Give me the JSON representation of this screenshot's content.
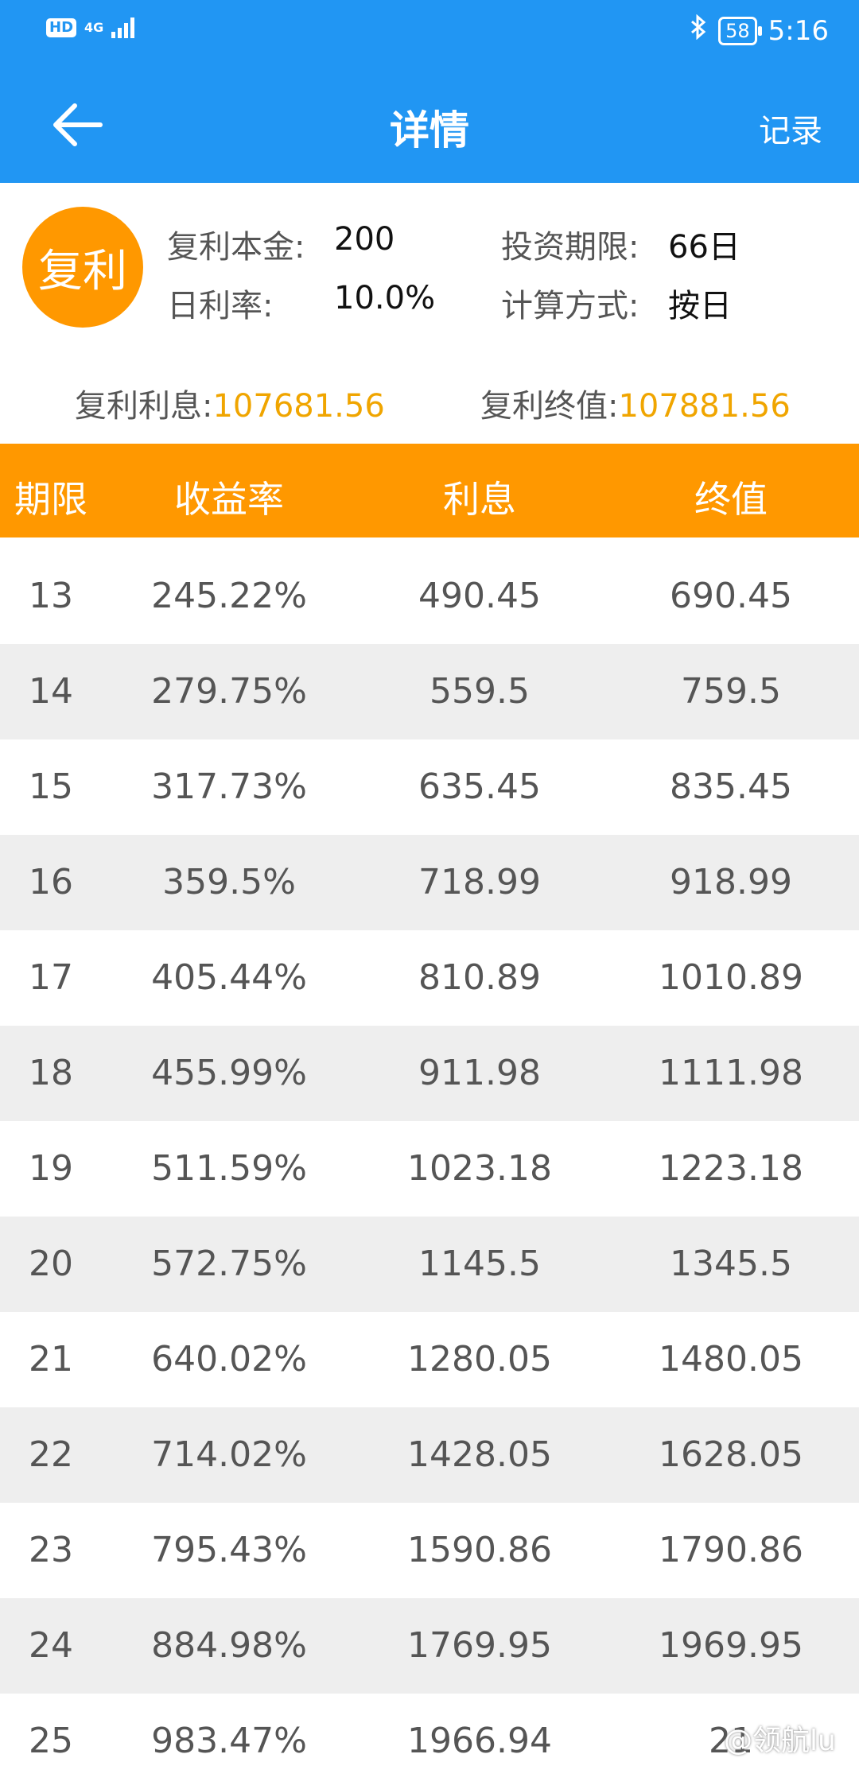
{
  "status": {
    "hd": "HD",
    "network": "4G",
    "battery": "58",
    "time": "5:16",
    "bluetooth_icon": "bluetooth-icon"
  },
  "toolbar": {
    "title": "详情",
    "record_label": "记录"
  },
  "summary": {
    "badge": "复利",
    "principal_label": "复利本金:",
    "principal_value": "200",
    "period_label": "投资期限:",
    "period_value": "66日",
    "rate_label": "日利率:",
    "rate_value": "10.0%",
    "method_label": "计算方式:",
    "method_value": "按日",
    "interest_label": "复利利息:",
    "interest_value": "107681.56",
    "final_label": "复利终值:",
    "final_value": "107881.56"
  },
  "table": {
    "headers": [
      "期限",
      "收益率",
      "利息",
      "终值"
    ],
    "rows": [
      [
        "13",
        "245.22%",
        "490.45",
        "690.45"
      ],
      [
        "14",
        "279.75%",
        "559.5",
        "759.5"
      ],
      [
        "15",
        "317.73%",
        "635.45",
        "835.45"
      ],
      [
        "16",
        "359.5%",
        "718.99",
        "918.99"
      ],
      [
        "17",
        "405.44%",
        "810.89",
        "1010.89"
      ],
      [
        "18",
        "455.99%",
        "911.98",
        "1111.98"
      ],
      [
        "19",
        "511.59%",
        "1023.18",
        "1223.18"
      ],
      [
        "20",
        "572.75%",
        "1145.5",
        "1345.5"
      ],
      [
        "21",
        "640.02%",
        "1280.05",
        "1480.05"
      ],
      [
        "22",
        "714.02%",
        "1428.05",
        "1628.05"
      ],
      [
        "23",
        "795.43%",
        "1590.86",
        "1790.86"
      ],
      [
        "24",
        "884.98%",
        "1769.95",
        "1969.95"
      ],
      [
        "25",
        "983.47%",
        "1966.94",
        "21"
      ]
    ]
  },
  "watermark": "@领航lu",
  "colors": {
    "primary": "#2196f3",
    "accent": "#ff9800",
    "highlight": "#f0a500"
  }
}
